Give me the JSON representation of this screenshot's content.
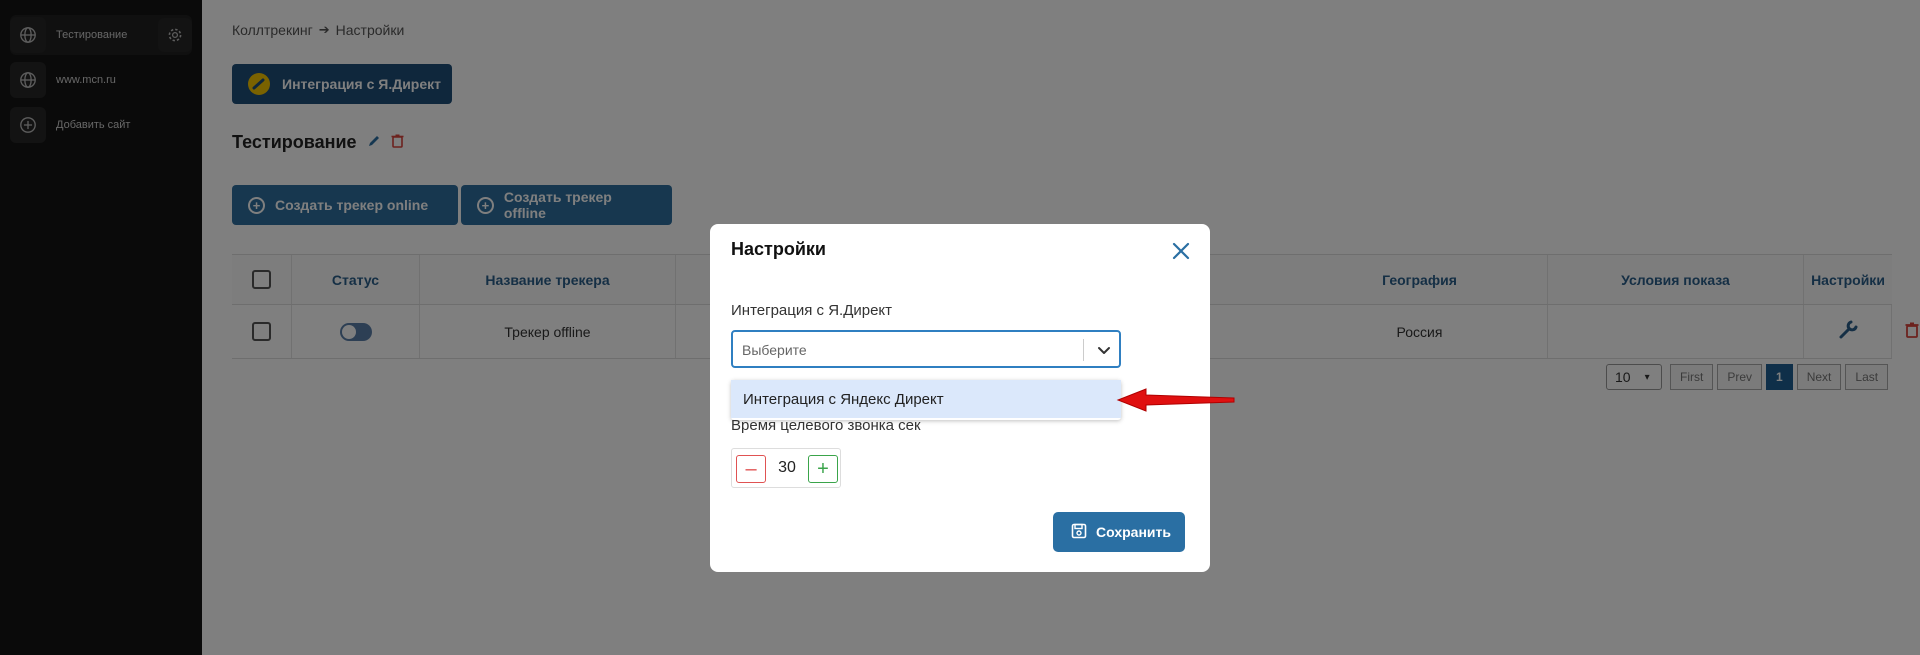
{
  "sidebar": {
    "sites": [
      {
        "label": "Тестирование",
        "active": true
      },
      {
        "label": "www.mcn.ru",
        "active": false
      },
      {
        "label": "Добавить сайт",
        "active": false
      }
    ]
  },
  "breadcrumb": {
    "root": "Коллтрекинг",
    "current": "Настройки"
  },
  "integration_button": "Интеграция с Я.Директ",
  "site_title": "Тестирование",
  "tracker_buttons": {
    "online": "Создать трекер online",
    "offline": "Создать трекер offline"
  },
  "table": {
    "headers": {
      "status": "Статус",
      "name": "Название трекера",
      "geo": "География",
      "conditions": "Условия показа",
      "settings": "Настройки"
    },
    "row": {
      "name": "Трекер offline",
      "geo": "Россия",
      "status_on": false
    }
  },
  "pagination": {
    "page_size": "10",
    "first": "First",
    "prev": "Prev",
    "current": "1",
    "next": "Next",
    "last": "Last"
  },
  "modal": {
    "title": "Настройки",
    "integration_label": "Интеграция с Я.Директ",
    "select_placeholder": "Выберите",
    "dropdown_option": "Интеграция с Яндекс Директ",
    "call_time_label": "Время целевого звонка сек",
    "call_time_value": "30",
    "minus": "–",
    "plus": "+",
    "save_label": "Сохранить"
  },
  "colors": {
    "accent": "#2a6fa3",
    "arrow": "#e01010",
    "delete": "#d9453c"
  }
}
